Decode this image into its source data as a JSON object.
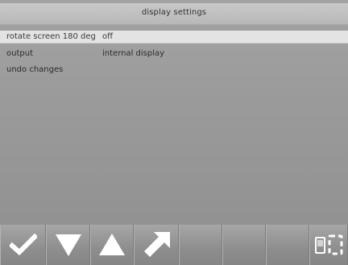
{
  "window": {
    "title": "display settings"
  },
  "settings": [
    {
      "label": "rotate screen 180 deg",
      "value": "off",
      "selected": true
    },
    {
      "label": "output",
      "value": "internal display",
      "selected": false
    },
    {
      "label": "undo changes",
      "value": "",
      "selected": false
    }
  ],
  "toolbar": {
    "buttons": [
      {
        "icon": "checkmark-icon"
      },
      {
        "icon": "down-arrow-icon"
      },
      {
        "icon": "up-arrow-icon"
      },
      {
        "icon": "diagonal-arrow-icon"
      },
      {
        "icon": ""
      },
      {
        "icon": ""
      },
      {
        "icon": ""
      },
      {
        "icon": "screen-switch-icon"
      }
    ]
  },
  "colors": {
    "background": "#9a9a9a",
    "titlebar": "#c2c2c2",
    "selected_row": "#e3e3e3",
    "icon": "#ffffff"
  }
}
